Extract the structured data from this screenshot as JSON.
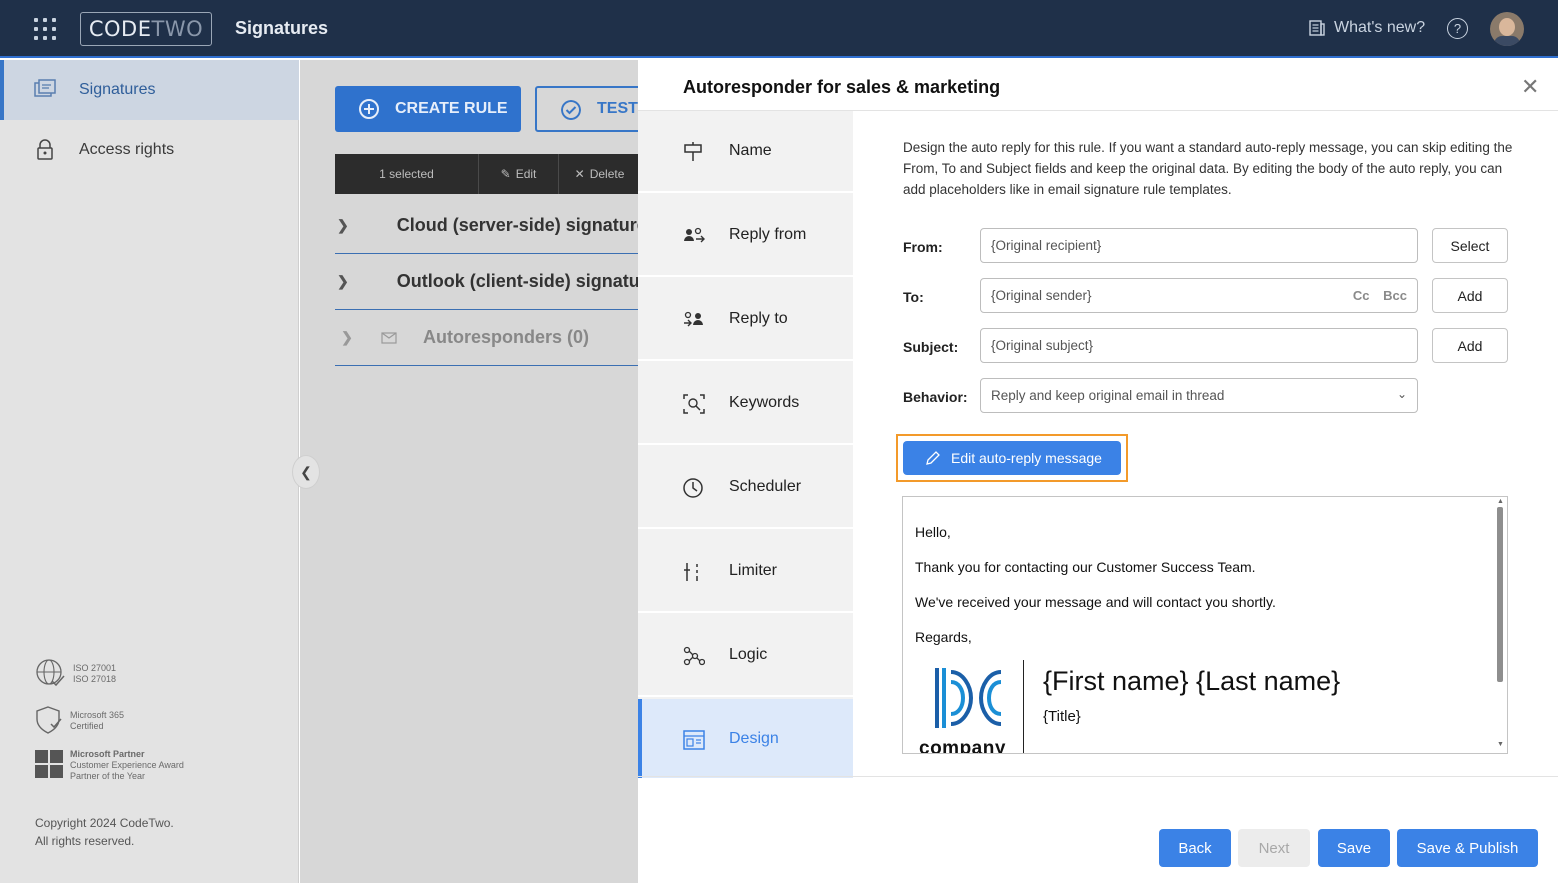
{
  "topbar": {
    "logo_left": "CODE",
    "logo_right": "TWO",
    "app_title": "Signatures",
    "whats_new": "What's new?",
    "help_glyph": "?"
  },
  "sidebar": {
    "items": [
      {
        "label": "Signatures",
        "icon": "signature-card-icon",
        "active": true
      },
      {
        "label": "Access rights",
        "icon": "lock-icon",
        "active": false
      }
    ],
    "certs": [
      {
        "line1": "ISO 27001",
        "line2": "ISO 27018"
      },
      {
        "line1": "Microsoft 365",
        "line2": "Certified"
      },
      {
        "line1": "Microsoft Partner",
        "line2": "Customer Experience Award",
        "line3": "Partner of the Year"
      }
    ],
    "copyright_line1": "Copyright 2024 CodeTwo.",
    "copyright_line2": "All rights reserved."
  },
  "main": {
    "create_rule": "CREATE RULE",
    "test": "TEST",
    "toolbar": {
      "selected": "1 selected",
      "edit": "Edit",
      "delete": "Delete"
    },
    "groups": [
      {
        "label": "Cloud (server-side) signatures",
        "icon": "cloud-icon"
      },
      {
        "label": "Outlook (client-side) signatures",
        "icon": "monitor-icon"
      },
      {
        "label": "Autoresponders (0)",
        "icon": "mail-reply-icon"
      }
    ]
  },
  "panel": {
    "title": "Autoresponder for sales & marketing",
    "steps": [
      {
        "label": "Name",
        "icon": "signpost-icon"
      },
      {
        "label": "Reply from",
        "icon": "reply-from-icon"
      },
      {
        "label": "Reply to",
        "icon": "reply-to-icon"
      },
      {
        "label": "Keywords",
        "icon": "keywords-icon"
      },
      {
        "label": "Scheduler",
        "icon": "clock-icon"
      },
      {
        "label": "Limiter",
        "icon": "limiter-icon"
      },
      {
        "label": "Logic",
        "icon": "logic-icon"
      },
      {
        "label": "Design",
        "icon": "design-icon"
      }
    ],
    "description": "Design the auto reply for this rule. If you want a standard auto-reply message, you can skip editing the From, To and Subject fields and keep the original data. By editing the body of the auto reply, you can add placeholders like in email signature rule templates.",
    "form": {
      "from_label": "From:",
      "from_value": "{Original recipient}",
      "from_button": "Select",
      "to_label": "To:",
      "to_value": "{Original sender}",
      "to_cc": "Cc",
      "to_bcc": "Bcc",
      "to_button": "Add",
      "subject_label": "Subject:",
      "subject_value": "{Original subject}",
      "subject_button": "Add",
      "behavior_label": "Behavior:",
      "behavior_value": "Reply and keep original email in thread"
    },
    "edit_button": "Edit auto-reply message",
    "preview": {
      "lines": [
        "Hello,",
        "Thank you for contacting our Customer Success Team.",
        "We've received your message and will contact you shortly.",
        "Regards,"
      ],
      "sig_name": "{First name} {Last name}",
      "sig_title": "{Title}",
      "company_word": "company"
    },
    "footer": {
      "back": "Back",
      "next": "Next",
      "save": "Save",
      "save_publish": "Save & Publish"
    }
  },
  "colors": {
    "topbar": "#1f3049",
    "accent": "#3b82e6",
    "highlight_border": "#f39a2a"
  }
}
